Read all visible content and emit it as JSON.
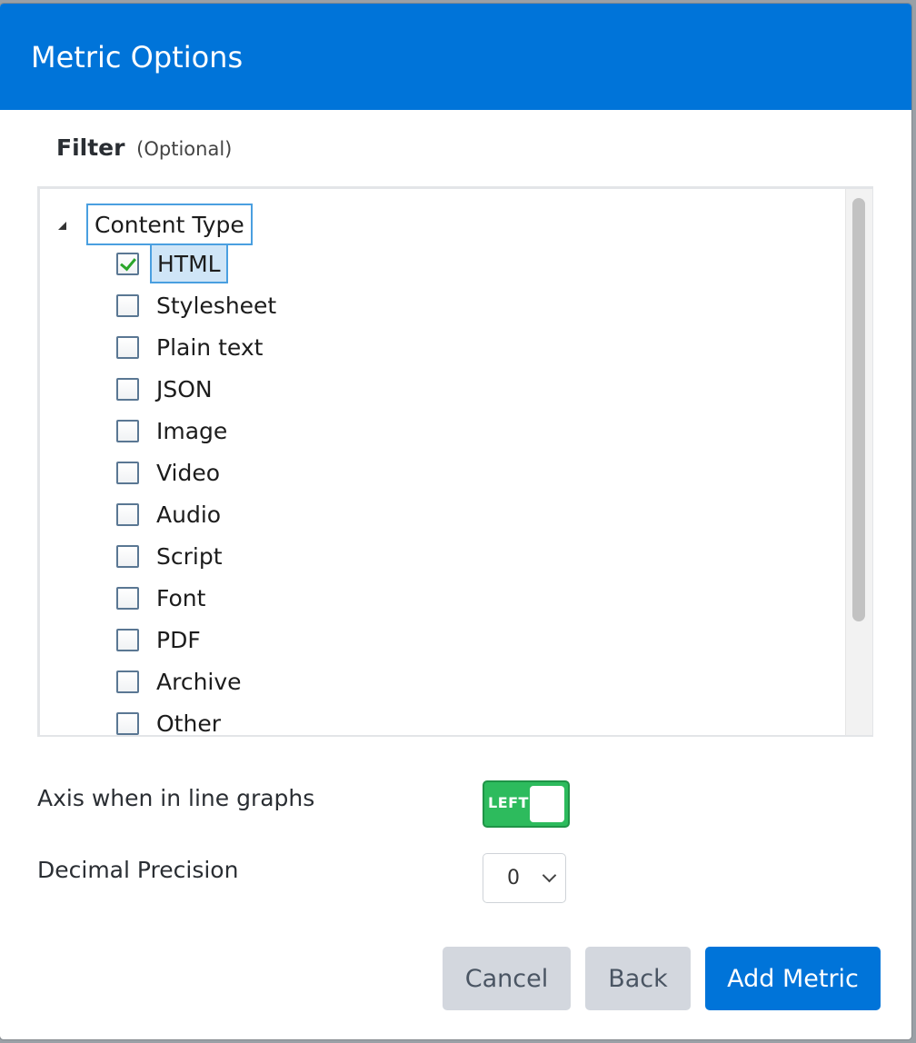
{
  "modal": {
    "title": "Metric Options"
  },
  "filter": {
    "heading": "Filter",
    "optional_hint": "(Optional)",
    "tree": {
      "root_label": "Content Type",
      "items": [
        {
          "label": "HTML",
          "checked": true
        },
        {
          "label": "Stylesheet",
          "checked": false
        },
        {
          "label": "Plain text",
          "checked": false
        },
        {
          "label": "JSON",
          "checked": false
        },
        {
          "label": "Image",
          "checked": false
        },
        {
          "label": "Video",
          "checked": false
        },
        {
          "label": "Audio",
          "checked": false
        },
        {
          "label": "Script",
          "checked": false
        },
        {
          "label": "Font",
          "checked": false
        },
        {
          "label": "PDF",
          "checked": false
        },
        {
          "label": "Archive",
          "checked": false
        },
        {
          "label": "Other",
          "checked": false
        }
      ]
    }
  },
  "axis": {
    "label": "Axis when in line graphs",
    "toggle_text": "LEFT"
  },
  "precision": {
    "label": "Decimal Precision",
    "value": "0"
  },
  "buttons": {
    "cancel": "Cancel",
    "back": "Back",
    "add_metric": "Add Metric"
  },
  "colors": {
    "header": "#0074d9",
    "toggle_on": "#2dbb5d",
    "primary_button": "#0074d9",
    "secondary_button": "#d3d7de",
    "check": "#2aa52a"
  }
}
